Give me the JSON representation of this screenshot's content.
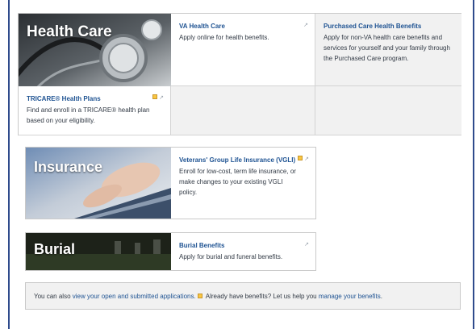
{
  "health_care": {
    "hero_title": "Health Care",
    "cards": [
      {
        "title": "VA Health Care",
        "text": "Apply online for health benefits."
      },
      {
        "title": "Purchased Care Health Benefits",
        "text": "Apply for non-VA health care benefits and services for yourself and your family through the Purchased Care program."
      },
      {
        "title": "TRICARE® Health Plans",
        "text": "Find and enroll in a TRICARE® health plan based on your eligibility."
      }
    ]
  },
  "insurance": {
    "hero_title": "Insurance",
    "card": {
      "title": "Veterans' Group Life Insurance (VGLI)",
      "text": "Enroll for low-cost, term life insurance, or make changes to your existing VGLI policy."
    }
  },
  "burial": {
    "hero_title": "Burial",
    "card": {
      "title": "Burial Benefits",
      "text": "Apply for burial and funeral benefits."
    }
  },
  "footer": {
    "prefix": "You can also ",
    "applications_link": "view your open and submitted applications.",
    "middle": " Already have benefits? Let us help you ",
    "manage_link": "manage your benefits",
    "suffix": "."
  },
  "icons": {
    "external": "external-link-icon",
    "badge": "notice-badge-icon"
  },
  "colors": {
    "link": "#205493",
    "border": "#2f4b8c",
    "badge": "#f9c642",
    "panel": "#f1f1f1"
  }
}
